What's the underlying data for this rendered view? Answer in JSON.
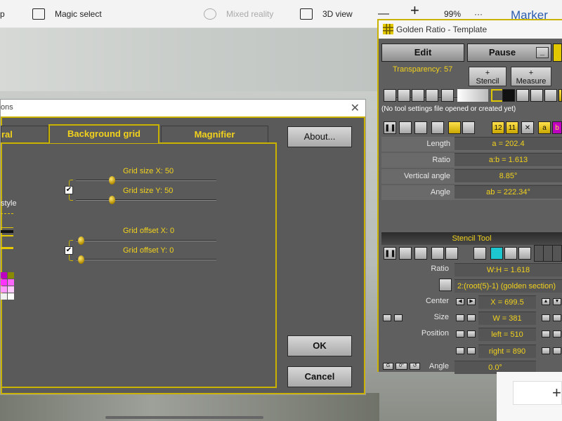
{
  "toolbar": {
    "item_cut": "p",
    "magic_select": "Magic select",
    "mixed_reality": "Mixed reality",
    "view_3d": "3D view",
    "zoom_minus": "—",
    "zoom_plus": "+",
    "zoom": "99%",
    "more": "···",
    "marker": "Marker"
  },
  "options_dialog": {
    "title": "ons",
    "close": "✕",
    "tabs": [
      "ral",
      "Background grid",
      "Magnifier"
    ],
    "about_button": "About...",
    "ok_button": "OK",
    "cancel_button": "Cancel",
    "style_label": "style",
    "grid_size_x": "Grid size X: 50",
    "grid_size_y": "Grid size Y: 50",
    "grid_offset_x": "Grid offset X: 0",
    "grid_offset_y": "Grid offset Y: 0",
    "check_mark": "✔",
    "swatch_colors": [
      "#c000c0",
      "#ff33ff",
      "#ff99ff",
      "#f0f0f0",
      "#8a8a00",
      "#ff66ff",
      "#ffccff",
      "#ffffff"
    ]
  },
  "golden_ratio": {
    "title": "Golden Ratio - Template",
    "edit_button": "Edit",
    "pause_button": "Pause",
    "minimize": "_",
    "transparency": "Transparency: 57",
    "stencil_button": "Stencil",
    "measure_button": "Measure",
    "plus": "+",
    "status": "(No tool settings file opened or created yet)",
    "measure_rows": [
      {
        "label": "Length",
        "value": "a = 202.4"
      },
      {
        "label": "Ratio",
        "value": "a:b = 1.613"
      },
      {
        "label": "Vertical angle",
        "value": "8.85°"
      },
      {
        "label": "Angle",
        "value": "ab = 222.34°"
      }
    ],
    "icons_row2": [
      "12",
      "11",
      "a",
      "b"
    ],
    "stencil_tool": "Stencil Tool",
    "stencil_ratio_label": "Ratio",
    "stencil_ratio_value": "W:H = 1.618",
    "formula": "2:(root(5)-1)  (golden section)",
    "center_label": "Center",
    "center_value": "X = 699.5",
    "size_label": "Size",
    "size_value": "W = 381",
    "position_label": "Position",
    "left_value": "left = 510",
    "right_value": "right = 890",
    "angle_label": "Angle",
    "angle_value": "0.0°",
    "angle_controls": [
      "G",
      "0°",
      "↺"
    ]
  }
}
